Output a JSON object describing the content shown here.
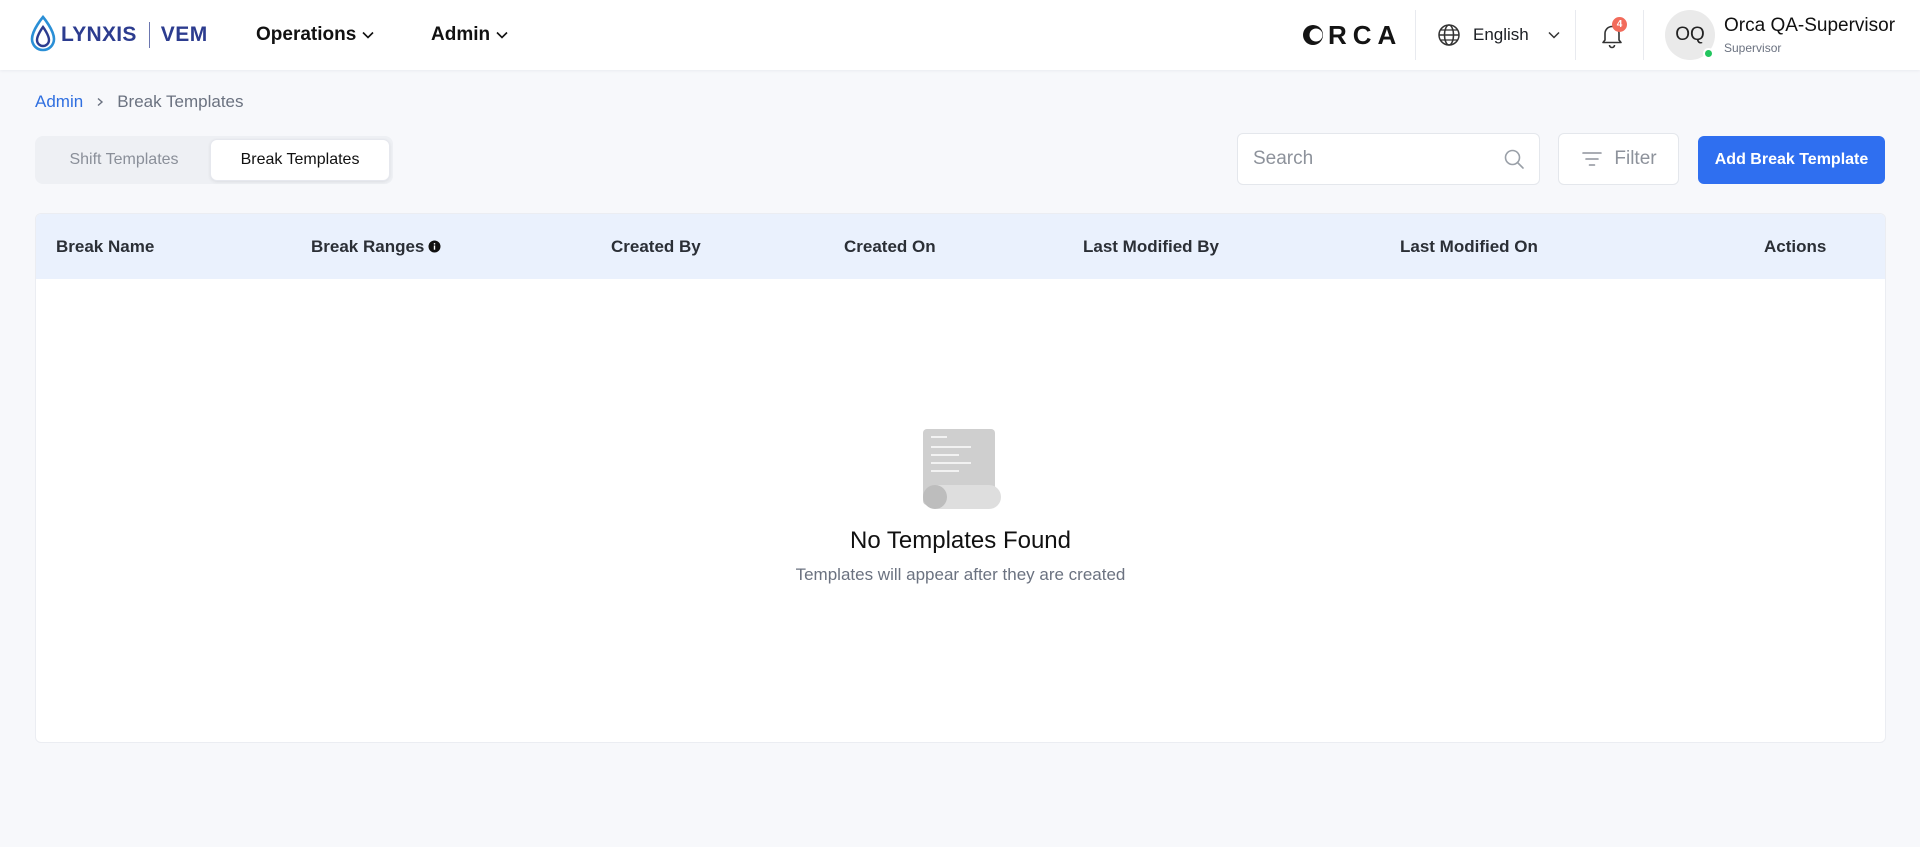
{
  "brand": {
    "logo_text": "LYNXIS",
    "logo_sub": "VEM",
    "partner_logo_text": "RCA",
    "accent": "#2f6ff0",
    "logo_color": "#2c3c8f"
  },
  "nav": {
    "items": [
      {
        "label": "Operations"
      },
      {
        "label": "Admin"
      }
    ]
  },
  "header": {
    "language": "English",
    "notifications_count": "4",
    "user": {
      "initials": "OQ",
      "name": "Orca QA-Supervisor",
      "role": "Supervisor",
      "status_color": "#22c55e"
    }
  },
  "breadcrumb": {
    "parent": "Admin",
    "current": "Break Templates"
  },
  "tabs": [
    {
      "label": "Shift Templates",
      "active": false
    },
    {
      "label": "Break Templates",
      "active": true
    }
  ],
  "toolbar": {
    "search_placeholder": "Search",
    "filter_label": "Filter",
    "add_label": "Add Break Template"
  },
  "table": {
    "columns": [
      "Break Name",
      "Break Ranges",
      "Created By",
      "Created On",
      "Last Modified By",
      "Last Modified On",
      "Actions"
    ],
    "rows": [],
    "empty_title": "No Templates Found",
    "empty_subtitle": "Templates will appear after they are created"
  },
  "icons": {
    "logo": "water-drop-icon",
    "nav_chevron": "chevron-down-icon",
    "language": "globe-icon",
    "notifications": "bell-icon",
    "search": "search-icon",
    "filter": "filter-icon",
    "info": "info-icon",
    "empty": "document-scroll-icon"
  }
}
